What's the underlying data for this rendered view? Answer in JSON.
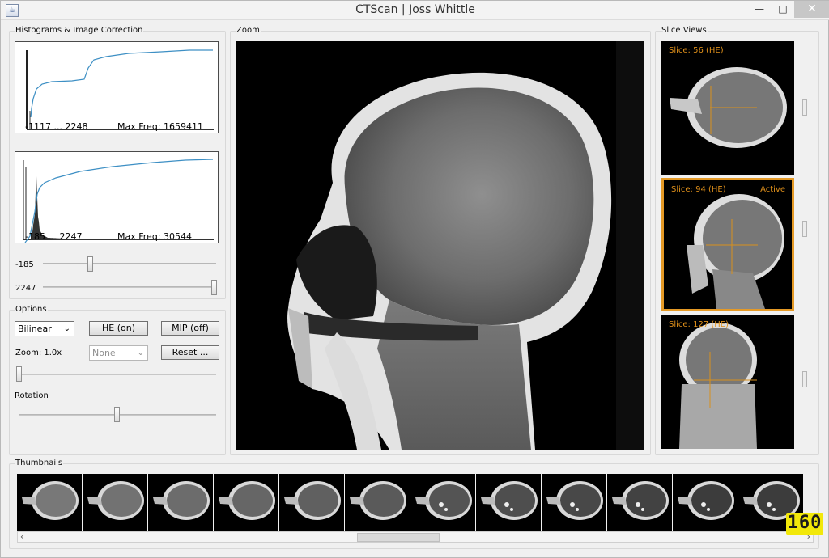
{
  "window": {
    "title": "CTScan | Joss Whittle",
    "app_icon": "java-cup-icon",
    "controls": {
      "minimize": "—",
      "maximize": "□",
      "close": "✕"
    }
  },
  "histograms": {
    "title": "Histograms & Image Correction",
    "top": {
      "range": "-1117 ... 2248",
      "max_freq": "Max Freq: 1659411"
    },
    "bottom": {
      "range": "-185 ... 2247",
      "max_freq": "Max Freq: 30544"
    },
    "low_slider": {
      "label": "-185",
      "level": 0.24
    },
    "high_slider": {
      "label": "2247",
      "level": 1.0
    }
  },
  "options": {
    "title": "Options",
    "interpolation": "Bilinear",
    "he_button": "HE (on)",
    "mip_button": "MIP (off)",
    "zoom_label": "Zoom: 1.0x",
    "mip_select": "None",
    "reset_button": "Reset ...",
    "zoom_slider_level": 0.0,
    "rotation_label": "Rotation",
    "rotation_slider_level": 0.5
  },
  "zoom": {
    "title": "Zoom"
  },
  "slice_views": {
    "title": "Slice Views",
    "slices": [
      {
        "label": "Slice: 56 (HE)",
        "active": false
      },
      {
        "label": "Slice: 94 (HE)",
        "active": true,
        "active_label": "Active"
      },
      {
        "label": "Slice: 127 (HE)",
        "active": false
      }
    ]
  },
  "thumbnails": {
    "title": "Thumbnails",
    "count_visible": 12
  },
  "fps": "160",
  "colors": {
    "accent": "#e59a26",
    "curve": "#3d8fc4",
    "fps_bg": "#f2e80a"
  }
}
